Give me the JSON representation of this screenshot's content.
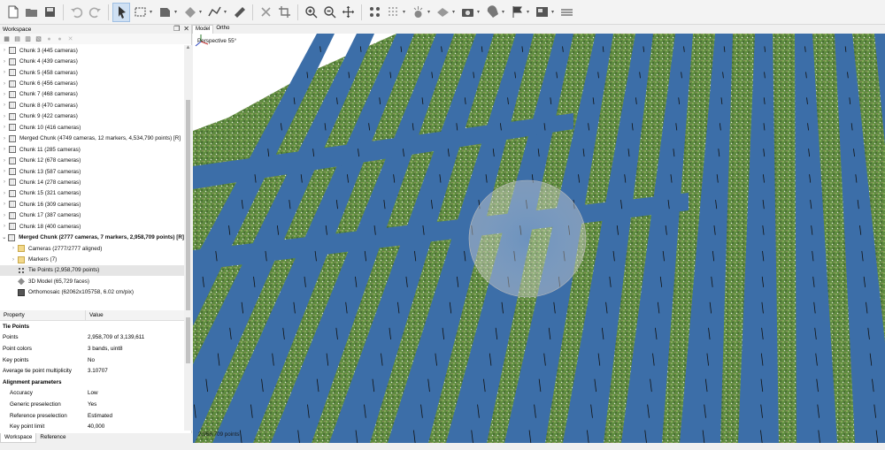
{
  "toolbar": {
    "icons": [
      "new-file-icon",
      "open-folder-icon",
      "save-icon",
      "undo-icon",
      "redo-icon",
      "navigation-pointer-icon",
      "rectangle-selection-icon",
      "model-selection-icon",
      "shape-selection-icon",
      "draw-polyline-icon",
      "ruler-icon",
      "delete-icon",
      "crop-icon",
      "zoom-in-icon",
      "zoom-out-icon",
      "move-icon",
      "point-cloud-icon",
      "dense-cloud-icon",
      "lighting-icon",
      "model-shading-icon",
      "camera-icon",
      "shapes-icon",
      "markers-flag-icon",
      "orthomosaic-icon",
      "layers-icon"
    ]
  },
  "workspace": {
    "title": "Workspace",
    "tree": [
      {
        "label": "Chunk 3 (445 cameras)",
        "level": 0,
        "type": "chunk"
      },
      {
        "label": "Chunk 4 (439 cameras)",
        "level": 0,
        "type": "chunk"
      },
      {
        "label": "Chunk 5 (458 cameras)",
        "level": 0,
        "type": "chunk"
      },
      {
        "label": "Chunk 6 (456 cameras)",
        "level": 0,
        "type": "chunk"
      },
      {
        "label": "Chunk 7 (468 cameras)",
        "level": 0,
        "type": "chunk"
      },
      {
        "label": "Chunk 8 (470 cameras)",
        "level": 0,
        "type": "chunk"
      },
      {
        "label": "Chunk 9 (422 cameras)",
        "level": 0,
        "type": "chunk"
      },
      {
        "label": "Chunk 10 (416 cameras)",
        "level": 0,
        "type": "chunk"
      },
      {
        "label": "Merged Chunk (4749 cameras, 12 markers, 4,534,790 points) [R]",
        "level": 0,
        "type": "chunk"
      },
      {
        "label": "Chunk 11 (285 cameras)",
        "level": 0,
        "type": "chunk"
      },
      {
        "label": "Chunk 12 (678 cameras)",
        "level": 0,
        "type": "chunk"
      },
      {
        "label": "Chunk 13 (587 cameras)",
        "level": 0,
        "type": "chunk"
      },
      {
        "label": "Chunk 14 (278 cameras)",
        "level": 0,
        "type": "chunk"
      },
      {
        "label": "Chunk 15 (321 cameras)",
        "level": 0,
        "type": "chunk"
      },
      {
        "label": "Chunk 16 (309 cameras)",
        "level": 0,
        "type": "chunk"
      },
      {
        "label": "Chunk 17 (387 cameras)",
        "level": 0,
        "type": "chunk"
      },
      {
        "label": "Chunk 18 (400 cameras)",
        "level": 0,
        "type": "chunk"
      },
      {
        "label": "Merged Chunk (2777 cameras, 7 markers, 2,958,709 points) [R]",
        "level": 0,
        "type": "chunk",
        "bold": true,
        "expanded": true
      },
      {
        "label": "Cameras (2777/2777 aligned)",
        "level": 1,
        "type": "folder"
      },
      {
        "label": "Markers (7)",
        "level": 1,
        "type": "folder"
      },
      {
        "label": "Tie Points (2,958,709 points)",
        "level": 1,
        "type": "tiepoints",
        "selected": true
      },
      {
        "label": "3D Model (65,729 faces)",
        "level": 1,
        "type": "model"
      },
      {
        "label": "Orthomosaic (62062x105758, 6.02 cm/pix)",
        "level": 1,
        "type": "ortho"
      }
    ]
  },
  "properties": {
    "col_property": "Property",
    "col_value": "Value",
    "rows": [
      {
        "key": "Tie Points",
        "value": "",
        "kind": "section"
      },
      {
        "key": "Points",
        "value": "2,958,709 of 3,139,611",
        "kind": "row"
      },
      {
        "key": "Point colors",
        "value": "3 bands, uint8",
        "kind": "row"
      },
      {
        "key": "Key points",
        "value": "No",
        "kind": "row"
      },
      {
        "key": "Average tie point multiplicity",
        "value": "3.10707",
        "kind": "row"
      },
      {
        "key": "Alignment parameters",
        "value": "",
        "kind": "section"
      },
      {
        "key": "Accuracy",
        "value": "Low",
        "kind": "indent"
      },
      {
        "key": "Generic preselection",
        "value": "Yes",
        "kind": "indent"
      },
      {
        "key": "Reference preselection",
        "value": "Estimated",
        "kind": "indent"
      },
      {
        "key": "Key point limit",
        "value": "40,000",
        "kind": "indent"
      }
    ]
  },
  "bottom_tabs": [
    "Workspace",
    "Reference"
  ],
  "view": {
    "tabs": [
      "Model",
      "Ortho"
    ],
    "perspective": "Perspective 55°",
    "points_readout": "2,958,709 points",
    "colors": {
      "mesh": "#3c6ea8",
      "vegetation": "#5f8f3e",
      "background": "#ffffff"
    }
  }
}
